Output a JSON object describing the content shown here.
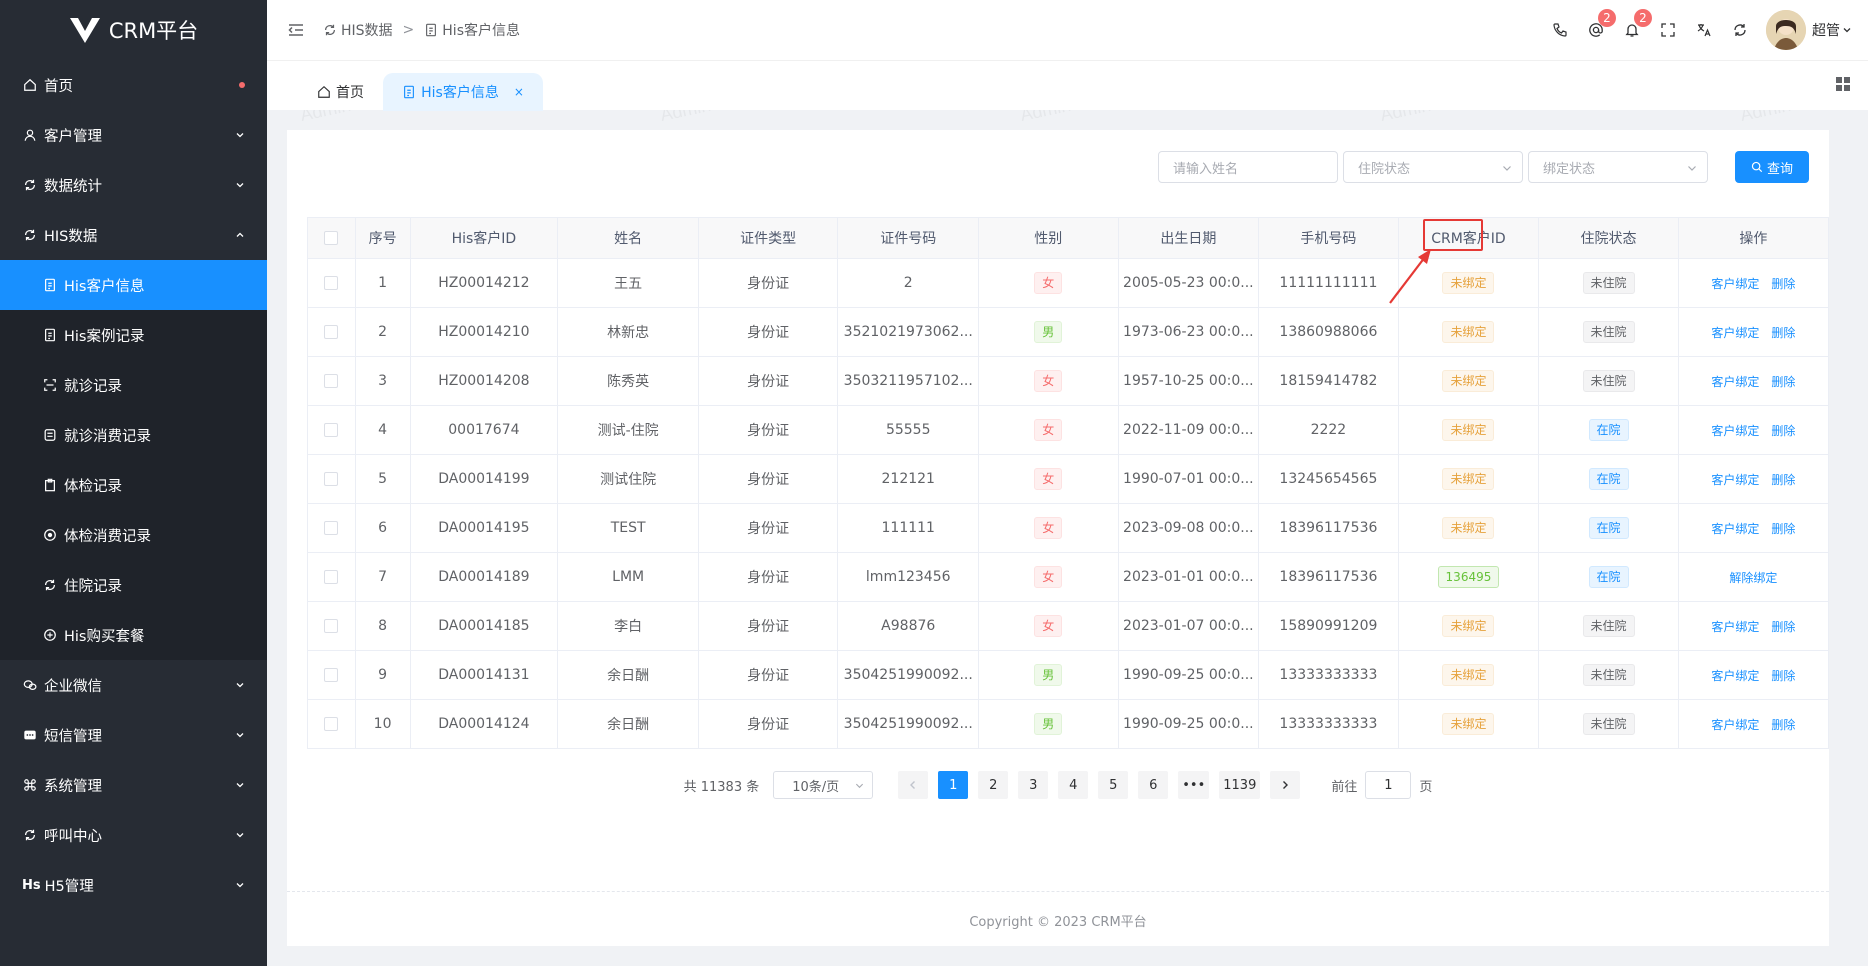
{
  "app": {
    "title": "CRM平台"
  },
  "sidebar": {
    "items": [
      {
        "label": "首页",
        "icon": "home-icon"
      },
      {
        "label": "客户管理",
        "icon": "user-icon"
      },
      {
        "label": "数据统计",
        "icon": "chart-icon"
      },
      {
        "label": "HIS数据",
        "icon": "refresh-icon"
      },
      {
        "label": "His客户信息",
        "icon": "document-icon"
      },
      {
        "label": "His案例记录",
        "icon": "document-icon"
      },
      {
        "label": "就诊记录",
        "icon": "scan-icon"
      },
      {
        "label": "就诊消费记录",
        "icon": "receipt-icon"
      },
      {
        "label": "体检记录",
        "icon": "clipboard-icon"
      },
      {
        "label": "体检消费记录",
        "icon": "target-icon"
      },
      {
        "label": "住院记录",
        "icon": "refresh-icon"
      },
      {
        "label": "His购买套餐",
        "icon": "gift-icon"
      },
      {
        "label": "企业微信",
        "icon": "wechat-icon"
      },
      {
        "label": "短信管理",
        "icon": "message-icon"
      },
      {
        "label": "系统管理",
        "icon": "command-icon"
      },
      {
        "label": "呼叫中心",
        "icon": "refresh-icon"
      },
      {
        "label": "H5管理",
        "icon": "h5-icon",
        "icon_text": "Hs"
      }
    ]
  },
  "header": {
    "breadcrumb": [
      "HIS数据",
      "His客户信息"
    ],
    "breadcrumb_sep": ">",
    "badges": {
      "at": "2",
      "bell": "2"
    },
    "user": "超管"
  },
  "tabs": {
    "home": "首页",
    "active": "His客户信息",
    "close": "×"
  },
  "search": {
    "name_placeholder": "请输入姓名",
    "hospital_placeholder": "住院状态",
    "bind_placeholder": "绑定状态",
    "button": "查询"
  },
  "table": {
    "headers": [
      "序号",
      "His客户ID",
      "姓名",
      "证件类型",
      "证件号码",
      "性别",
      "出生日期",
      "手机号码",
      "CRM客户ID",
      "住院状态",
      "操作"
    ],
    "rows": [
      {
        "no": "1",
        "his_id": "HZ00014212",
        "name": "王五",
        "id_type": "身份证",
        "id_no": "2",
        "gender": "女",
        "birth": "2005-05-23 00:0...",
        "phone": "11111111111",
        "crm_id": "未绑定",
        "hosp": "未住院"
      },
      {
        "no": "2",
        "his_id": "HZ00014210",
        "name": "林新忠",
        "id_type": "身份证",
        "id_no": "3521021973062...",
        "gender": "男",
        "birth": "1973-06-23 00:0...",
        "phone": "13860988066",
        "crm_id": "未绑定",
        "hosp": "未住院"
      },
      {
        "no": "3",
        "his_id": "HZ00014208",
        "name": "陈秀英",
        "id_type": "身份证",
        "id_no": "3503211957102...",
        "gender": "女",
        "birth": "1957-10-25 00:0...",
        "phone": "18159414782",
        "crm_id": "未绑定",
        "hosp": "未住院"
      },
      {
        "no": "4",
        "his_id": "00017674",
        "name": "测试-住院",
        "id_type": "身份证",
        "id_no": "55555",
        "gender": "女",
        "birth": "2022-11-09 00:0...",
        "phone": "2222",
        "crm_id": "未绑定",
        "hosp": "在院"
      },
      {
        "no": "5",
        "his_id": "DA00014199",
        "name": "测试住院",
        "id_type": "身份证",
        "id_no": "212121",
        "gender": "女",
        "birth": "1990-07-01 00:0...",
        "phone": "13245654565",
        "crm_id": "未绑定",
        "hosp": "在院"
      },
      {
        "no": "6",
        "his_id": "DA00014195",
        "name": "TEST",
        "id_type": "身份证",
        "id_no": "111111",
        "gender": "女",
        "birth": "2023-09-08 00:0...",
        "phone": "18396117536",
        "crm_id": "未绑定",
        "hosp": "在院"
      },
      {
        "no": "7",
        "his_id": "DA00014189",
        "name": "LMM",
        "id_type": "身份证",
        "id_no": "lmm123456",
        "gender": "女",
        "birth": "2023-01-01 00:0...",
        "phone": "18396117536",
        "crm_id": "136495",
        "hosp": "在院"
      },
      {
        "no": "8",
        "his_id": "DA00014185",
        "name": "李白",
        "id_type": "身份证",
        "id_no": "A98876",
        "gender": "女",
        "birth": "2023-01-07 00:0...",
        "phone": "15890991209",
        "crm_id": "未绑定",
        "hosp": "未住院"
      },
      {
        "no": "9",
        "his_id": "DA00014131",
        "name": "余日酬",
        "id_type": "身份证",
        "id_no": "3504251990092...",
        "gender": "男",
        "birth": "1990-09-25 00:0...",
        "phone": "13333333333",
        "crm_id": "未绑定",
        "hosp": "未住院"
      },
      {
        "no": "10",
        "his_id": "DA00014124",
        "name": "余日酬",
        "id_type": "身份证",
        "id_no": "3504251990092...",
        "gender": "男",
        "birth": "1990-09-25 00:0...",
        "phone": "13333333333",
        "crm_id": "未绑定",
        "hosp": "未住院"
      }
    ],
    "op_bind": "客户绑定",
    "op_delete": "删除",
    "op_unbind": "解除绑定"
  },
  "pagination": {
    "total": "共 11383 条",
    "page_size": "10条/页",
    "pages": [
      "1",
      "2",
      "3",
      "4",
      "5",
      "6",
      "•••",
      "1139"
    ],
    "current": "1",
    "goto_prefix": "前往",
    "goto_value": "1",
    "goto_suffix": "页"
  },
  "footer": {
    "text": "Copyright © 2023 CRM平台"
  },
  "watermark": "Admin",
  "colors": {
    "primary": "#1890ff",
    "sidebar": "#272c34",
    "danger": "#f56c6c",
    "warning": "#e6a23c",
    "success": "#67c23a",
    "annotation": "#e53935"
  }
}
